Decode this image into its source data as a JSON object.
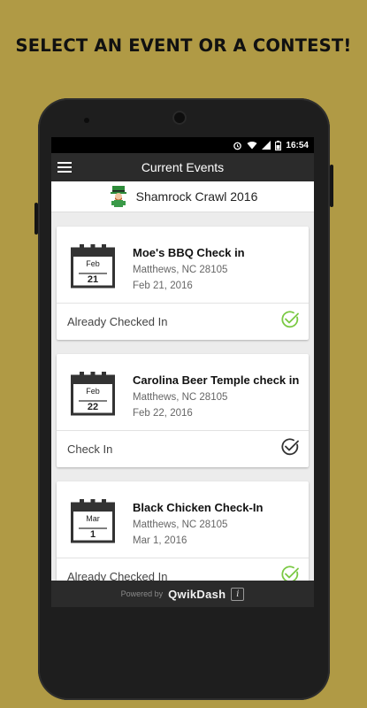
{
  "headline": "SELECT AN EVENT OR A CONTEST!",
  "status_bar": {
    "time": "16:54"
  },
  "app_bar": {
    "title": "Current Events"
  },
  "event": {
    "name": "Shamrock Crawl 2016",
    "icon": "leprechaun-icon"
  },
  "cards": [
    {
      "name": "Moe's BBQ Check in",
      "location": "Matthews, NC 28105",
      "date": "Feb 21, 2016",
      "cal_month": "Feb",
      "cal_day": "21",
      "status": "Already Checked In",
      "checked": true
    },
    {
      "name": "Carolina Beer Temple check in",
      "location": "Matthews, NC 28105",
      "date": "Feb 22, 2016",
      "cal_month": "Feb",
      "cal_day": "22",
      "status": "Check In",
      "checked": false
    },
    {
      "name": "Black Chicken Check-In",
      "location": "Matthews, NC 28105",
      "date": "Mar 1, 2016",
      "cal_month": "Mar",
      "cal_day": "1",
      "status": "Already Checked In",
      "checked": true
    }
  ],
  "footer": {
    "powered_by": "Powered by",
    "brand": "QwikDash",
    "info": "i"
  },
  "colors": {
    "background": "#b09a45",
    "checked": "#7ac943",
    "unchecked": "#333333",
    "app_bar": "#2b2b2b"
  }
}
